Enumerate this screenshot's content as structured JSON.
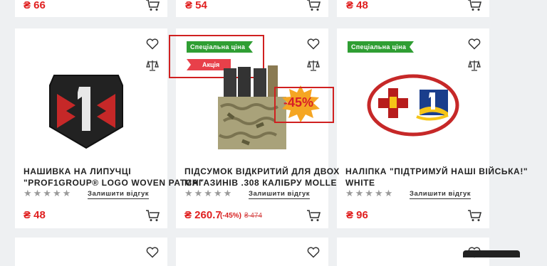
{
  "top_row": [
    {
      "price": "₴ 66"
    },
    {
      "price": "₴ 54"
    },
    {
      "price": "₴ 48"
    }
  ],
  "products": [
    {
      "title_line1": "Нашивка на липучці",
      "title_line2": "\"Prof1Group® Logo Woven Patch\"",
      "stars": "★★★★★",
      "review_label": "Залишити відгук",
      "price": "₴ 48"
    },
    {
      "badge_special": "Спеціальна ціна",
      "badge_sale": "Акція",
      "discount_sticker": "-45%",
      "title_line1": "Підсумок відкритий для двох",
      "title_line2": "магазинів .308 калібру MOLLE",
      "stars": "★★★★★",
      "review_label": "Залишити відгук",
      "price": "₴ 260.7",
      "discount": "(-45%)",
      "old_price": "₴ 474"
    },
    {
      "badge_special": "Спеціальна ціна",
      "title_line1": "Наліпка \"Підтримуй наші війська!\"",
      "title_line2": "White",
      "stars": "★★★★★",
      "review_label": "Залишити відгук",
      "price": "₴ 96"
    }
  ],
  "colors": {
    "price": "#e02020",
    "badge_green": "#2f9e33",
    "badge_red": "#e8404a",
    "highlight": "#e02020"
  },
  "icons": [
    "cart-icon",
    "heart-icon",
    "compare-icon"
  ]
}
